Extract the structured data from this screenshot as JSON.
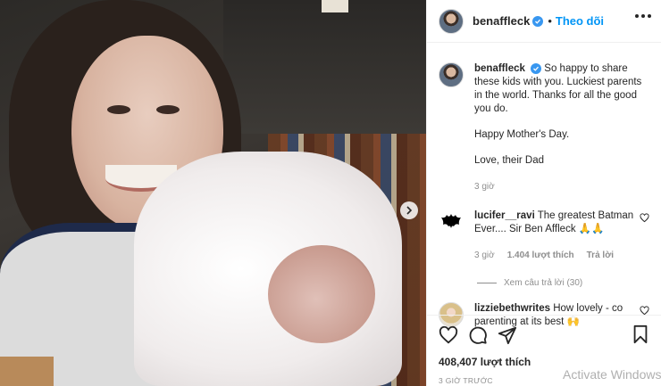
{
  "post": {
    "username": "benaffleck",
    "follow_label": "Theo dõi",
    "separator": "•"
  },
  "caption": {
    "username": "benaffleck",
    "text": "So happy to share these kids with you. Luckiest parents in the world. Thanks for all the good you do.",
    "line2": "Happy Mother's Day.",
    "line3": "Love, their Dad",
    "time": "3 giờ"
  },
  "comments": [
    {
      "username": "lucifer__ravi",
      "text": "The greatest Batman Ever.... Sir Ben Affleck 🙏🙏",
      "time": "3 giờ",
      "likes": "1.404 lượt thích",
      "reply_label": "Trả lời",
      "view_replies": "Xem câu trả lời (30)"
    },
    {
      "username": "lizziebethwrites",
      "text": "How lovely - co parenting at its best 🙌"
    }
  ],
  "footer": {
    "likes": "408,407 lượt thích",
    "time": "3 GIỜ TRƯỚC"
  },
  "overlay": {
    "watermark": "Activate Windows"
  },
  "icons": [
    "chevron-right-icon",
    "verified-badge-icon",
    "more-options-icon",
    "heart-icon",
    "comment-icon",
    "share-icon",
    "bookmark-icon"
  ],
  "colors": {
    "follow": "#0095f6",
    "verified": "#3897f0",
    "muted": "#8e8e8e"
  }
}
